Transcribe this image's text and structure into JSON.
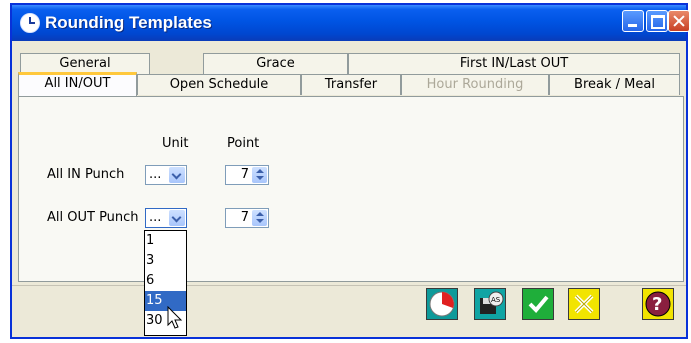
{
  "window": {
    "title": "Rounding Templates"
  },
  "tabs": {
    "row1": [
      "General",
      "Grace",
      "First IN/Last OUT"
    ],
    "row2": [
      "All IN/OUT",
      "Open Schedule",
      "Transfer",
      "Hour Rounding",
      "Break / Meal"
    ],
    "active": "All IN/OUT",
    "disabled": "Hour Rounding"
  },
  "panel": {
    "col_unit": "Unit",
    "col_point": "Point",
    "in_label": "All IN Punch",
    "out_label": "All OUT Punch",
    "in_unit_value": "...",
    "out_unit_value": "...",
    "in_point_value": "7",
    "out_point_value": "7"
  },
  "dropdown": {
    "options": [
      "1",
      "3",
      "6",
      "15",
      "30"
    ],
    "highlighted": "15"
  },
  "footer_icons": [
    "clock-icon",
    "save-template-icon",
    "ok-check-icon",
    "cancel-x-icon",
    "help-icon"
  ],
  "colors": {
    "titlebar": "#0054e3",
    "active_tab_accent": "#ffc83c",
    "selection": "#316ac5",
    "ok": "#20b020",
    "cancel": "#f0e000",
    "help": "#8a1f3f"
  }
}
